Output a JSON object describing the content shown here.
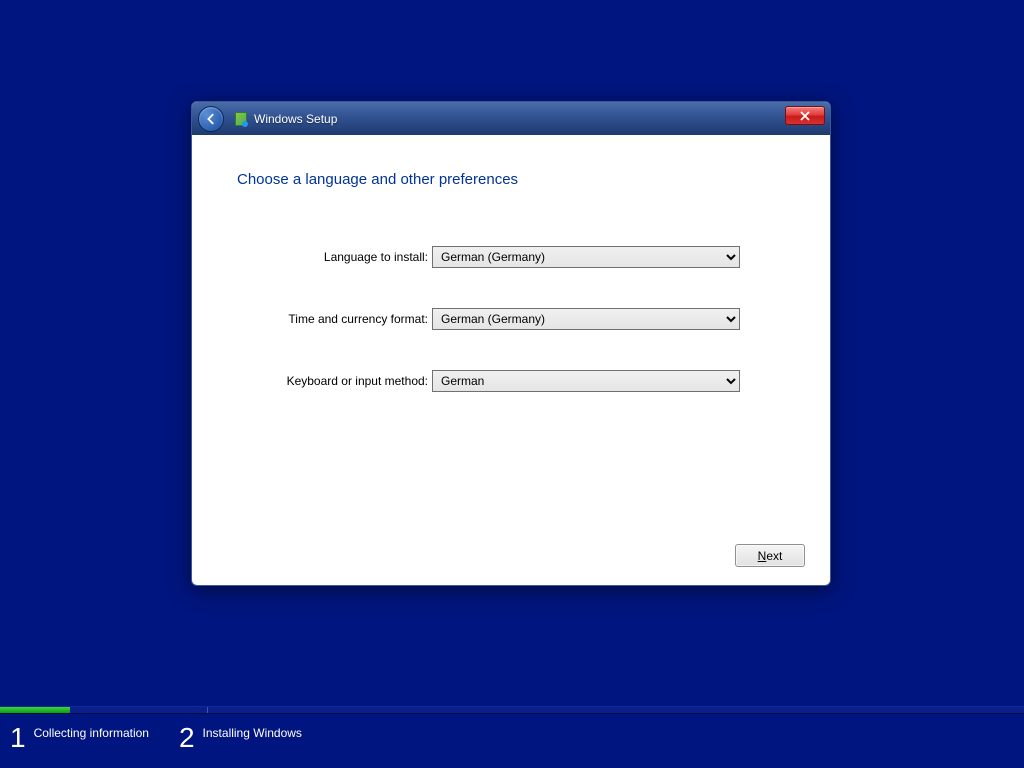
{
  "window": {
    "title": "Windows Setup",
    "heading": "Choose a language and other preferences"
  },
  "fields": {
    "language": {
      "label": "Language to install:",
      "value": "German (Germany)"
    },
    "time": {
      "label": "Time and currency format:",
      "value": "German (Germany)"
    },
    "keyboard": {
      "label": "Keyboard or input method:",
      "value": "German"
    }
  },
  "buttons": {
    "next_prefix": "N",
    "next_rest": "ext"
  },
  "footer": {
    "step1_num": "1",
    "step1_label": "Collecting information",
    "step2_num": "2",
    "step2_label": "Installing Windows"
  }
}
